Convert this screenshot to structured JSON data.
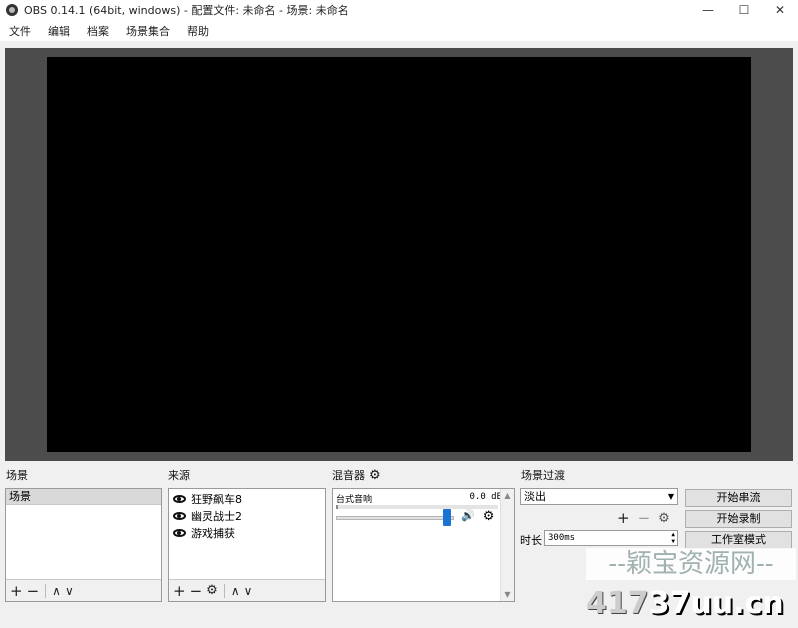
{
  "window": {
    "title": "OBS 0.14.1 (64bit, windows) - 配置文件: 未命名 - 场景: 未命名",
    "minimize": "—",
    "maximize": "☐",
    "close": "✕"
  },
  "menu": [
    "文件",
    "编辑",
    "档案",
    "场景集合",
    "帮助"
  ],
  "scenes": {
    "title": "场景",
    "items": [
      "场景"
    ]
  },
  "sources": {
    "title": "来源",
    "items": [
      "狂野飙车8",
      "幽灵战士2",
      "游戏捕获"
    ]
  },
  "mixer": {
    "title": "混音器",
    "channel": {
      "name": "台式音响",
      "level": "0.0 dB",
      "volume_fraction": 0.97
    }
  },
  "transitions": {
    "title": "场景过渡",
    "selected": "淡出",
    "duration_label": "时长",
    "duration_value": "300ms"
  },
  "controls": {
    "start_streaming": "开始串流",
    "start_recording": "开始录制",
    "studio_mode": "工作室模式"
  },
  "toolbar_glyphs": {
    "add": "+",
    "remove": "−",
    "up": "∧",
    "down": "∨",
    "gear": "⚙",
    "speaker": "🔊"
  },
  "watermark": {
    "top": "--颖宝资源网--",
    "bottom_prefix": "417",
    "bottom_main": "37uu.cn"
  },
  "colors": {
    "preview_bg": "#4c4c4c",
    "canvas": "#000000",
    "fader": "#1a73d0"
  }
}
